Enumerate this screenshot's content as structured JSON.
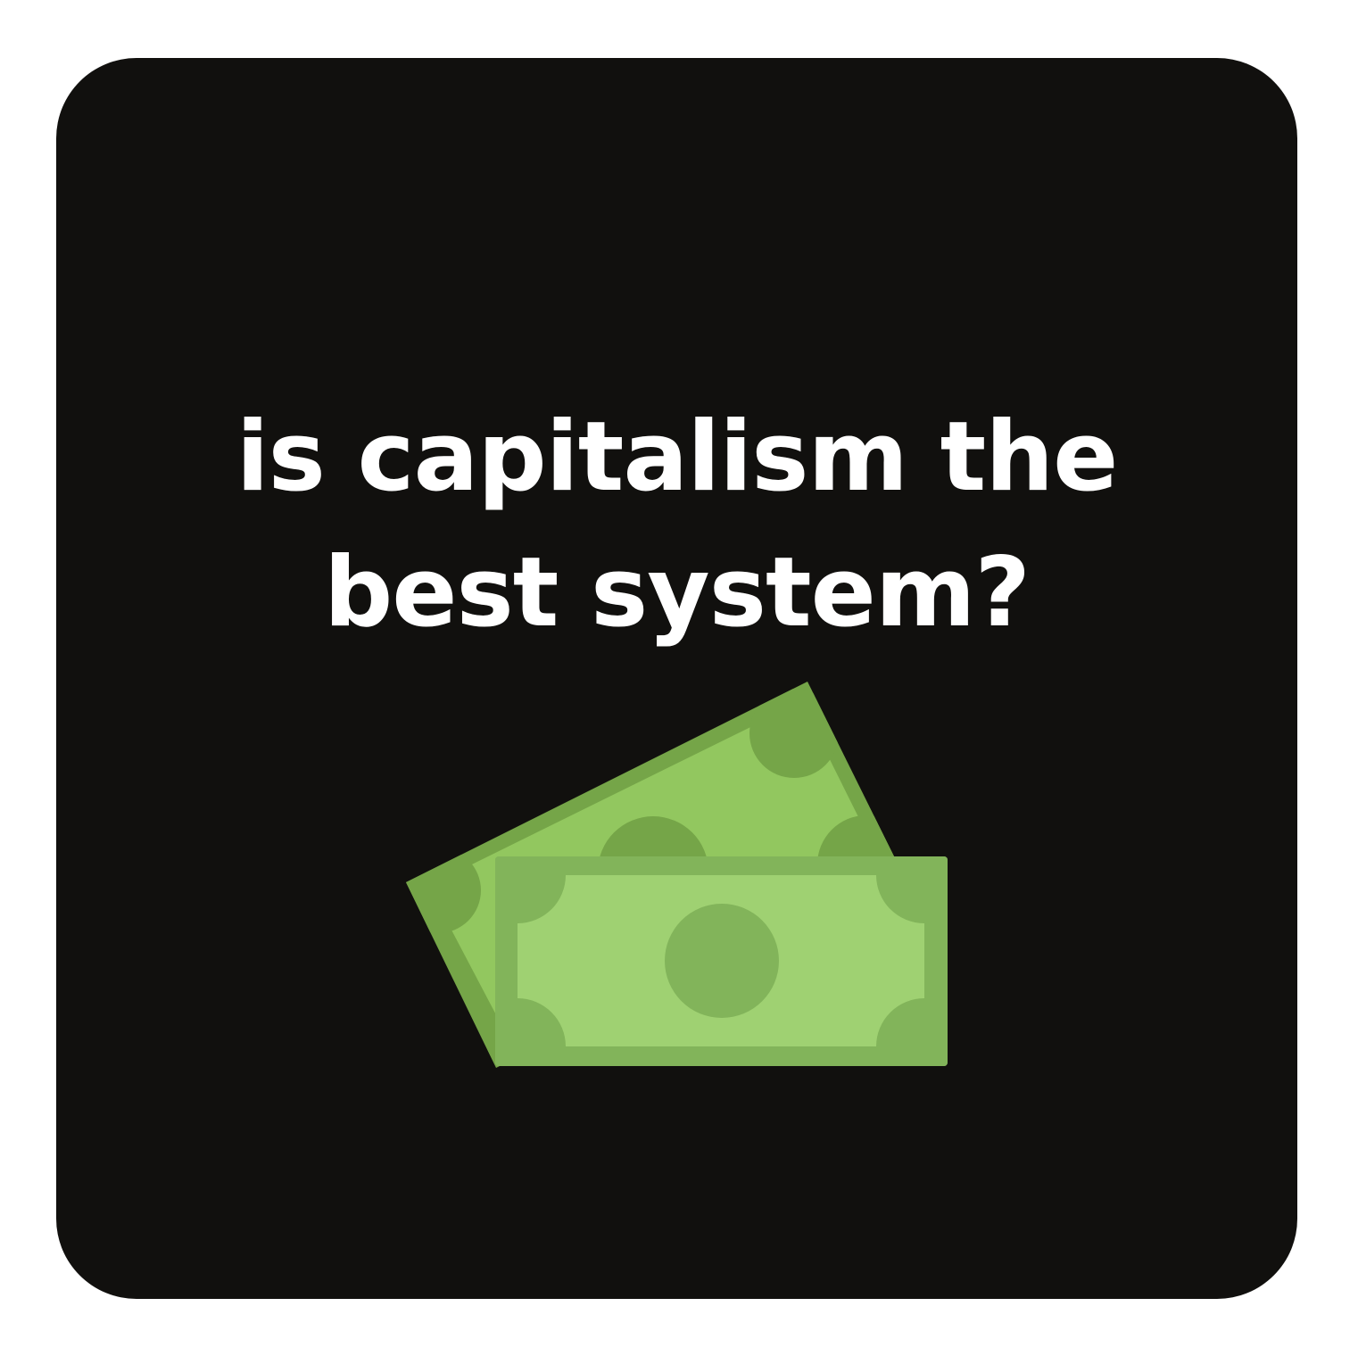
{
  "headline": {
    "line1": "is capitalism the",
    "line2": "best system?"
  },
  "illustration": {
    "icon": "money-bills-icon",
    "colors": {
      "card_background": "#11100e",
      "headline_text": "#ffffff",
      "back_bill_border": "#75a548",
      "back_bill_face": "#92c75f",
      "front_bill_border": "#82b45a",
      "front_bill_face": "#9fd172"
    }
  }
}
